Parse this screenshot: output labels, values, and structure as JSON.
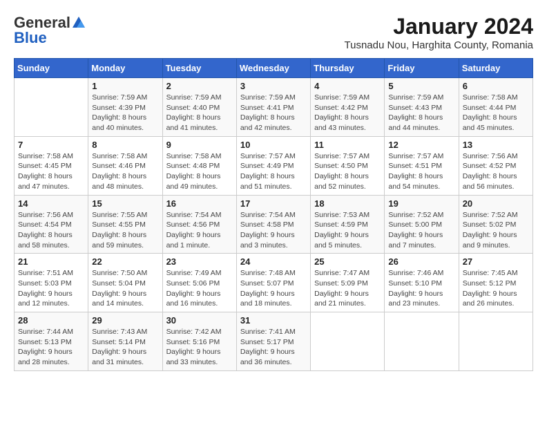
{
  "header": {
    "logo_general": "General",
    "logo_blue": "Blue",
    "month_title": "January 2024",
    "location": "Tusnadu Nou, Harghita County, Romania"
  },
  "weekdays": [
    "Sunday",
    "Monday",
    "Tuesday",
    "Wednesday",
    "Thursday",
    "Friday",
    "Saturday"
  ],
  "weeks": [
    [
      {
        "day": "",
        "info": ""
      },
      {
        "day": "1",
        "info": "Sunrise: 7:59 AM\nSunset: 4:39 PM\nDaylight: 8 hours\nand 40 minutes."
      },
      {
        "day": "2",
        "info": "Sunrise: 7:59 AM\nSunset: 4:40 PM\nDaylight: 8 hours\nand 41 minutes."
      },
      {
        "day": "3",
        "info": "Sunrise: 7:59 AM\nSunset: 4:41 PM\nDaylight: 8 hours\nand 42 minutes."
      },
      {
        "day": "4",
        "info": "Sunrise: 7:59 AM\nSunset: 4:42 PM\nDaylight: 8 hours\nand 43 minutes."
      },
      {
        "day": "5",
        "info": "Sunrise: 7:59 AM\nSunset: 4:43 PM\nDaylight: 8 hours\nand 44 minutes."
      },
      {
        "day": "6",
        "info": "Sunrise: 7:58 AM\nSunset: 4:44 PM\nDaylight: 8 hours\nand 45 minutes."
      }
    ],
    [
      {
        "day": "7",
        "info": "Sunrise: 7:58 AM\nSunset: 4:45 PM\nDaylight: 8 hours\nand 47 minutes."
      },
      {
        "day": "8",
        "info": "Sunrise: 7:58 AM\nSunset: 4:46 PM\nDaylight: 8 hours\nand 48 minutes."
      },
      {
        "day": "9",
        "info": "Sunrise: 7:58 AM\nSunset: 4:48 PM\nDaylight: 8 hours\nand 49 minutes."
      },
      {
        "day": "10",
        "info": "Sunrise: 7:57 AM\nSunset: 4:49 PM\nDaylight: 8 hours\nand 51 minutes."
      },
      {
        "day": "11",
        "info": "Sunrise: 7:57 AM\nSunset: 4:50 PM\nDaylight: 8 hours\nand 52 minutes."
      },
      {
        "day": "12",
        "info": "Sunrise: 7:57 AM\nSunset: 4:51 PM\nDaylight: 8 hours\nand 54 minutes."
      },
      {
        "day": "13",
        "info": "Sunrise: 7:56 AM\nSunset: 4:52 PM\nDaylight: 8 hours\nand 56 minutes."
      }
    ],
    [
      {
        "day": "14",
        "info": "Sunrise: 7:56 AM\nSunset: 4:54 PM\nDaylight: 8 hours\nand 58 minutes."
      },
      {
        "day": "15",
        "info": "Sunrise: 7:55 AM\nSunset: 4:55 PM\nDaylight: 8 hours\nand 59 minutes."
      },
      {
        "day": "16",
        "info": "Sunrise: 7:54 AM\nSunset: 4:56 PM\nDaylight: 9 hours\nand 1 minute."
      },
      {
        "day": "17",
        "info": "Sunrise: 7:54 AM\nSunset: 4:58 PM\nDaylight: 9 hours\nand 3 minutes."
      },
      {
        "day": "18",
        "info": "Sunrise: 7:53 AM\nSunset: 4:59 PM\nDaylight: 9 hours\nand 5 minutes."
      },
      {
        "day": "19",
        "info": "Sunrise: 7:52 AM\nSunset: 5:00 PM\nDaylight: 9 hours\nand 7 minutes."
      },
      {
        "day": "20",
        "info": "Sunrise: 7:52 AM\nSunset: 5:02 PM\nDaylight: 9 hours\nand 9 minutes."
      }
    ],
    [
      {
        "day": "21",
        "info": "Sunrise: 7:51 AM\nSunset: 5:03 PM\nDaylight: 9 hours\nand 12 minutes."
      },
      {
        "day": "22",
        "info": "Sunrise: 7:50 AM\nSunset: 5:04 PM\nDaylight: 9 hours\nand 14 minutes."
      },
      {
        "day": "23",
        "info": "Sunrise: 7:49 AM\nSunset: 5:06 PM\nDaylight: 9 hours\nand 16 minutes."
      },
      {
        "day": "24",
        "info": "Sunrise: 7:48 AM\nSunset: 5:07 PM\nDaylight: 9 hours\nand 18 minutes."
      },
      {
        "day": "25",
        "info": "Sunrise: 7:47 AM\nSunset: 5:09 PM\nDaylight: 9 hours\nand 21 minutes."
      },
      {
        "day": "26",
        "info": "Sunrise: 7:46 AM\nSunset: 5:10 PM\nDaylight: 9 hours\nand 23 minutes."
      },
      {
        "day": "27",
        "info": "Sunrise: 7:45 AM\nSunset: 5:12 PM\nDaylight: 9 hours\nand 26 minutes."
      }
    ],
    [
      {
        "day": "28",
        "info": "Sunrise: 7:44 AM\nSunset: 5:13 PM\nDaylight: 9 hours\nand 28 minutes."
      },
      {
        "day": "29",
        "info": "Sunrise: 7:43 AM\nSunset: 5:14 PM\nDaylight: 9 hours\nand 31 minutes."
      },
      {
        "day": "30",
        "info": "Sunrise: 7:42 AM\nSunset: 5:16 PM\nDaylight: 9 hours\nand 33 minutes."
      },
      {
        "day": "31",
        "info": "Sunrise: 7:41 AM\nSunset: 5:17 PM\nDaylight: 9 hours\nand 36 minutes."
      },
      {
        "day": "",
        "info": ""
      },
      {
        "day": "",
        "info": ""
      },
      {
        "day": "",
        "info": ""
      }
    ]
  ]
}
